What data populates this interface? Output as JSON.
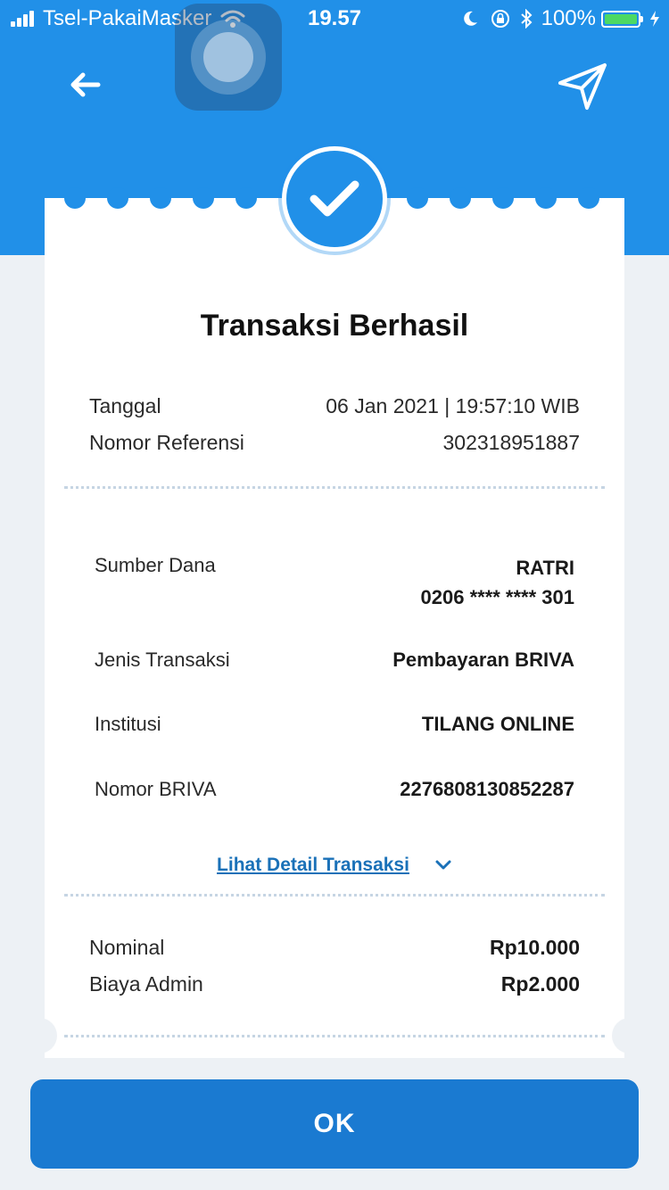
{
  "status_bar": {
    "carrier": "Tsel-PakaiMasker",
    "time": "19.57",
    "battery": "100%"
  },
  "icons": {
    "back": "arrow-left-icon",
    "share": "paper-plane-icon",
    "success": "checkmark-icon",
    "expand": "chevron-down-icon"
  },
  "receipt": {
    "title": "Transaksi Berhasil",
    "tanggal_label": "Tanggal",
    "tanggal_value": "06 Jan 2021 | 19:57:10 WIB",
    "referensi_label": "Nomor Referensi",
    "referensi_value": "302318951887",
    "details": {
      "sumber_label": "Sumber Dana",
      "sumber_name": "RATRI",
      "sumber_account": "0206 **** **** 301",
      "jenis_label": "Jenis Transaksi",
      "jenis_value": "Pembayaran BRIVA",
      "institusi_label": "Institusi",
      "institusi_value": "TILANG ONLINE",
      "briva_label": "Nomor BRIVA",
      "briva_value": "2276808130852287"
    },
    "detail_link": "Lihat Detail Transaksi",
    "nominal_label": "Nominal",
    "nominal_value": "Rp10.000",
    "admin_label": "Biaya Admin",
    "admin_value": "Rp2.000"
  },
  "actions": {
    "ok_label": "OK"
  },
  "colors": {
    "primary": "#2190e8",
    "button": "#1a7ad1",
    "link": "#1a71b8",
    "battery": "#4cd964"
  }
}
